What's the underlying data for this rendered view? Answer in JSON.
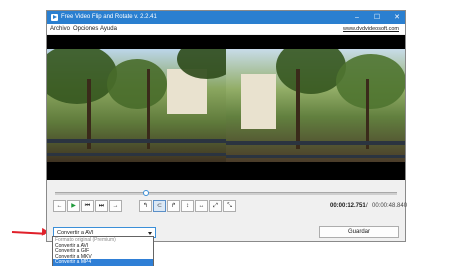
{
  "window": {
    "title": "Free Video Flip and Rotate v. 2.2.41",
    "controls": {
      "minimize": "–",
      "maximize": "☐",
      "close": "✕"
    }
  },
  "menu": {
    "items": [
      {
        "label": "Archivo"
      },
      {
        "label": "Opciones"
      },
      {
        "label": "Ayuda"
      }
    ],
    "site_link": "www.dvdvideosoft.com"
  },
  "player": {
    "progress_fraction": 0.265,
    "transport_buttons": [
      {
        "icon": "step-back-icon",
        "glyph": "←"
      },
      {
        "icon": "play-icon",
        "glyph": "▶"
      },
      {
        "icon": "skip-start-icon",
        "glyph": "⏮"
      },
      {
        "icon": "skip-end-icon",
        "glyph": "⏭"
      },
      {
        "icon": "step-forward-icon",
        "glyph": "→"
      }
    ],
    "rotate_buttons": [
      {
        "icon": "rotate-left-icon",
        "glyph": "↰"
      },
      {
        "icon": "rotate-180-icon",
        "glyph": "⊂"
      },
      {
        "icon": "rotate-right-icon",
        "glyph": "↱"
      },
      {
        "icon": "flip-vertical-icon",
        "glyph": "↕"
      },
      {
        "icon": "flip-horizontal-icon",
        "glyph": "↔"
      },
      {
        "icon": "diagonal-flip-icon",
        "glyph": "⤢"
      },
      {
        "icon": "anti-diagonal-flip-icon",
        "glyph": "⤡"
      }
    ],
    "current_time": "00:00:12.751",
    "time_separator": "/",
    "total_time": "00:00:48.840"
  },
  "format_select": {
    "selected": "Convertir a AVI",
    "options": [
      {
        "label": "Formato original (Premium)",
        "state": "disabled"
      },
      {
        "label": "Convertir a AVI",
        "state": "normal"
      },
      {
        "label": "Convertir a GIF",
        "state": "normal"
      },
      {
        "label": "Convertir a MKV",
        "state": "normal"
      },
      {
        "label": "Convertir a MP4",
        "state": "highlighted"
      }
    ]
  },
  "save_button": {
    "label": "Guardar"
  },
  "colors": {
    "titlebar": "#2a7fd0",
    "highlight": "#2f7fd6",
    "annotation_arrow": "#e0202a"
  }
}
